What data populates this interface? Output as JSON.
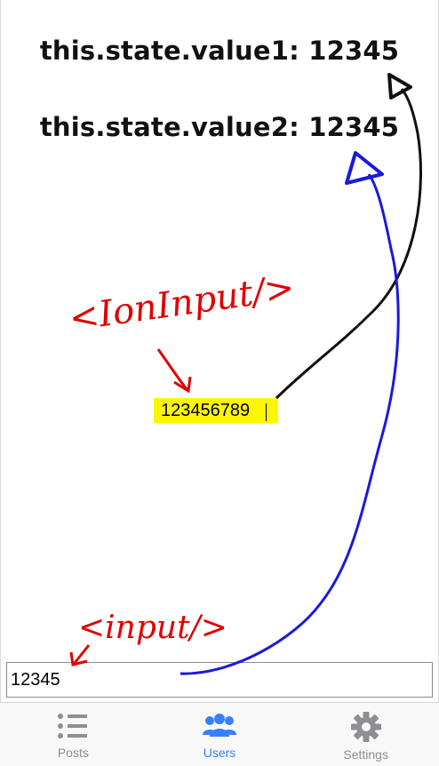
{
  "state": {
    "value1_line": "this.state.value1: 12345",
    "value2_line": "this.state.value2: 12345"
  },
  "ion_input": {
    "value": "123456789"
  },
  "native_input": {
    "value": "12345"
  },
  "annotations": {
    "ion_input_label": "<IonInput/>",
    "input_label": "<input/>"
  },
  "tabs": [
    {
      "label": "Posts",
      "icon": "list-icon",
      "color": "#8e8e93",
      "selected": false
    },
    {
      "label": "Users",
      "icon": "people-icon",
      "color": "#3880ff",
      "selected": true
    },
    {
      "label": "Settings",
      "icon": "gear-icon",
      "color": "#8e8e93",
      "selected": false
    }
  ],
  "colors": {
    "highlight": "#fdf600",
    "accent": "#3880ff",
    "inactive": "#8e8e93",
    "annotation_red": "#e00000",
    "annotation_blue": "#1a1adc"
  }
}
